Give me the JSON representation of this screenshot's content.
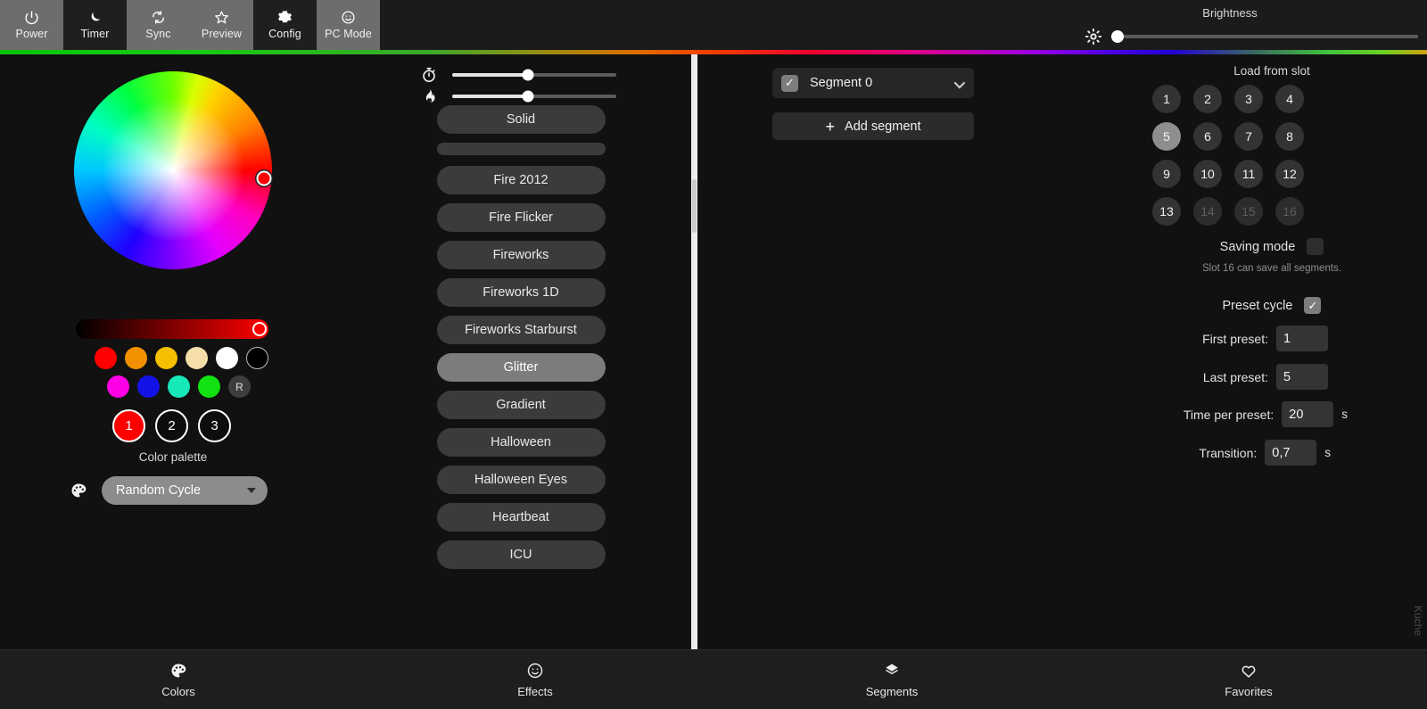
{
  "topbar": {
    "items": [
      {
        "label": "Power",
        "icon": "power-icon",
        "state": "light"
      },
      {
        "label": "Timer",
        "icon": "moon-icon",
        "state": "dark"
      },
      {
        "label": "Sync",
        "icon": "sync-icon",
        "state": "light"
      },
      {
        "label": "Preview",
        "icon": "star-icon",
        "state": "light"
      },
      {
        "label": "Config",
        "icon": "gear-icon",
        "state": "dark"
      },
      {
        "label": "PC Mode",
        "icon": "smiley-icon",
        "state": "light"
      }
    ],
    "brightness_label": "Brightness",
    "brightness_percent": 2
  },
  "colors": {
    "wheel_selected_hex": "#ff0000",
    "value_bar_hex": "#ff0000",
    "swatches_row1": [
      "#ff0000",
      "#f29100",
      "#f5c000",
      "#f5deaa",
      "#ffffff",
      "#000000"
    ],
    "swatches_row2": [
      "#ff00e6",
      "#1313e8",
      "#17e8b8",
      "#12e112"
    ],
    "random_swatch_label": "R",
    "color_slots": [
      {
        "label": "1",
        "color": "#ff0000",
        "active": true
      },
      {
        "label": "2",
        "color": "#0d0d0d",
        "active": false
      },
      {
        "label": "3",
        "color": "#0d0d0d",
        "active": false
      }
    ],
    "palette_caption": "Color palette",
    "palette_selected": "Random Cycle"
  },
  "effects": {
    "speed_percent": 46,
    "intensity_percent": 46,
    "list": [
      {
        "label": "Solid",
        "selected": false,
        "clipped": false
      },
      {
        "label": "",
        "selected": false,
        "clipped": true
      },
      {
        "label": "Fire 2012",
        "selected": false,
        "clipped": false
      },
      {
        "label": "Fire Flicker",
        "selected": false,
        "clipped": false
      },
      {
        "label": "Fireworks",
        "selected": false,
        "clipped": false
      },
      {
        "label": "Fireworks 1D",
        "selected": false,
        "clipped": false
      },
      {
        "label": "Fireworks Starburst",
        "selected": false,
        "clipped": false
      },
      {
        "label": "Glitter",
        "selected": true,
        "clipped": false
      },
      {
        "label": "Gradient",
        "selected": false,
        "clipped": false
      },
      {
        "label": "Halloween",
        "selected": false,
        "clipped": false
      },
      {
        "label": "Halloween Eyes",
        "selected": false,
        "clipped": false
      },
      {
        "label": "Heartbeat",
        "selected": false,
        "clipped": false
      },
      {
        "label": "ICU",
        "selected": false,
        "clipped": false
      }
    ]
  },
  "segments": {
    "selected_segment": "Segment 0",
    "segment_enabled": true,
    "add_segment_label": "Add segment",
    "add_icon": "plus-icon"
  },
  "favorites": {
    "load_title": "Load from slot",
    "slots": [
      {
        "label": "1",
        "state": "normal"
      },
      {
        "label": "2",
        "state": "normal"
      },
      {
        "label": "3",
        "state": "normal"
      },
      {
        "label": "4",
        "state": "normal"
      },
      {
        "label": "5",
        "state": "active"
      },
      {
        "label": "6",
        "state": "normal"
      },
      {
        "label": "7",
        "state": "normal"
      },
      {
        "label": "8",
        "state": "normal"
      },
      {
        "label": "9",
        "state": "normal"
      },
      {
        "label": "10",
        "state": "normal"
      },
      {
        "label": "11",
        "state": "normal"
      },
      {
        "label": "12",
        "state": "normal"
      },
      {
        "label": "13",
        "state": "normal"
      },
      {
        "label": "14",
        "state": "disabled"
      },
      {
        "label": "15",
        "state": "disabled"
      },
      {
        "label": "16",
        "state": "disabled"
      }
    ],
    "saving_mode_label": "Saving mode",
    "saving_mode_checked": false,
    "saving_hint": "Slot 16 can save all segments.",
    "preset_cycle_label": "Preset cycle",
    "preset_cycle_checked": true,
    "first_preset_label": "First preset:",
    "first_preset_value": "1",
    "last_preset_label": "Last preset:",
    "last_preset_value": "5",
    "time_per_preset_label": "Time per preset:",
    "time_per_preset_value": "20",
    "time_unit": "s",
    "transition_label": "Transition:",
    "transition_value": "0,7",
    "transition_unit": "s"
  },
  "device_name": "Küche",
  "bottomnav": {
    "items": [
      {
        "label": "Colors",
        "icon": "palette-icon"
      },
      {
        "label": "Effects",
        "icon": "smiley-icon"
      },
      {
        "label": "Segments",
        "icon": "layers-icon"
      },
      {
        "label": "Favorites",
        "icon": "heart-icon"
      }
    ]
  }
}
